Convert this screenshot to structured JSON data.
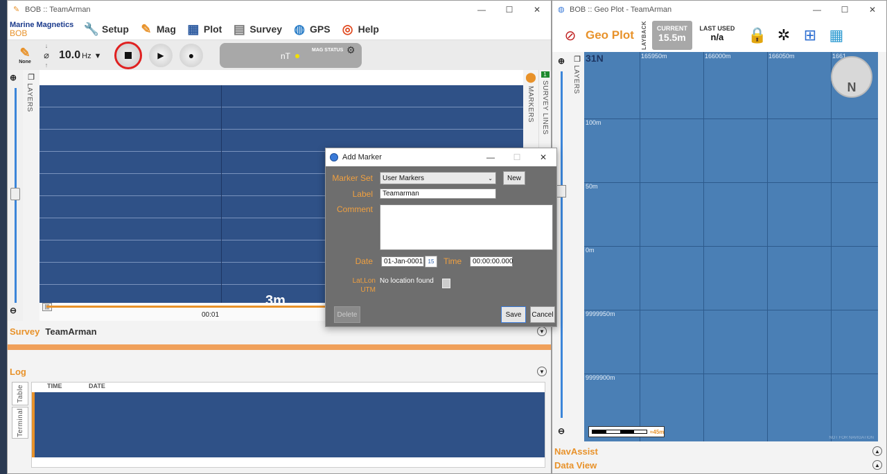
{
  "left_window": {
    "title": "BOB :: TeamArman",
    "controls": {
      "minimize": "—",
      "maximize": "☐",
      "close": "✕"
    },
    "brand": {
      "line1": "Marine Magnetics",
      "line2": "BOB"
    },
    "menu": {
      "setup": "Setup",
      "mag": "Mag",
      "plot": "Plot",
      "survey": "Survey",
      "gps": "GPS",
      "help": "Help"
    },
    "toolbar": {
      "none_label": "None",
      "phase_symbol": "⌀",
      "rate_value": "10.0",
      "rate_unit": "Hz",
      "mag_status": {
        "value": "nT",
        "label": "MAG STATUS"
      }
    },
    "plot": {
      "layers_label": "LAYERS",
      "markers_label": "MARKERS",
      "survey_lines_label": "SURVEY LINES",
      "survey_lines_badge": "1",
      "scale_label": "3m",
      "time_label": "00:01"
    },
    "survey": {
      "title": "Survey",
      "name": "TeamArman"
    },
    "log": {
      "title": "Log",
      "tabs": [
        "Table",
        "Terminal"
      ],
      "columns": [
        "TIME",
        "DATE"
      ]
    }
  },
  "right_window": {
    "title": "BOB :: Geo Plot - TeamArman",
    "controls": {
      "minimize": "—",
      "maximize": "☐",
      "close": "✕"
    },
    "geo_title": "Geo Plot",
    "layback_label": "LAYBACK",
    "current": {
      "label": "CURRENT",
      "value": "15.5m"
    },
    "last_used": {
      "label": "LAST USED",
      "value": "n/a"
    },
    "layers_label": "LAYERS",
    "map": {
      "zone_label": "31N",
      "x_labels": [
        "165950m",
        "166000m",
        "166050m",
        "1661"
      ],
      "y_labels": [
        "100m",
        "50m",
        "0m",
        "9999950m",
        "9999900m"
      ],
      "compass_letter": "N",
      "scale_label": "≈45m",
      "watermark": "NOT FOR NAVIGATION"
    },
    "nav_assist": "NavAssist",
    "data_view": "Data View"
  },
  "dialog": {
    "title": "Add Marker",
    "controls": {
      "minimize": "—",
      "maximize": "☐",
      "close": "✕"
    },
    "marker_set_label": "Marker Set",
    "marker_set_value": "User Markers",
    "new_button": "New",
    "label_label": "Label",
    "label_value": "Teamarman",
    "comment_label": "Comment",
    "comment_value": "",
    "date_label": "Date",
    "date_value": "01-Jan-0001",
    "calendar_day": "15",
    "time_label": "Time",
    "time_value": "00:00:00.000",
    "latlon_label": "Lat,Lon",
    "utm_label": "UTM",
    "location_text": "No location found",
    "delete_button": "Delete",
    "save_button": "Save",
    "cancel_button": "Cancel"
  },
  "colors": {
    "accent": "#e8922a",
    "plot_bg": "#2f5187",
    "map_bg": "#4a7fb5",
    "record": "#e02020"
  }
}
